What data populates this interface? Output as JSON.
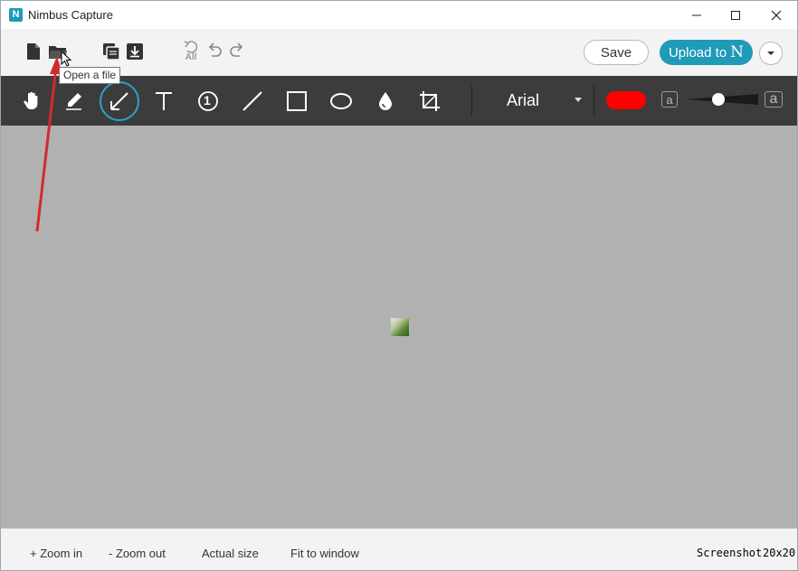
{
  "window": {
    "title": "Nimbus Capture",
    "app_icon_letter": "N"
  },
  "toolbar": {
    "save_label": "Save",
    "upload_label": "Upload to",
    "upload_logo": "N",
    "tooltip": "Open a  file",
    "undo_all_label": "All"
  },
  "draw_toolbar": {
    "font": "Arial",
    "active_color": "#ff0000",
    "size_small_label": "a",
    "size_big_label": "a",
    "accent_color": "#26a6c6"
  },
  "icons": {
    "new": "new-file-icon",
    "open": "open-folder-icon",
    "copy": "copy-icon",
    "download": "download-icon",
    "undo_all": "undo-all-icon",
    "undo": "undo-icon",
    "redo": "redo-icon",
    "hand": "hand-icon",
    "pen": "pen-icon",
    "arrow": "arrow-icon",
    "text": "text-icon",
    "number": "numbered-marker-icon",
    "line": "line-icon",
    "rect": "rectangle-icon",
    "ellipse": "ellipse-icon",
    "blur": "blur-drop-icon",
    "crop": "crop-icon"
  },
  "number_tool_label": "1",
  "statusbar": {
    "zoom_in": "+ Zoom in",
    "zoom_out": "- Zoom out",
    "actual_size": "Actual size",
    "fit_window": "Fit to window",
    "mode": "Screenshot",
    "dimensions": "20x20"
  }
}
